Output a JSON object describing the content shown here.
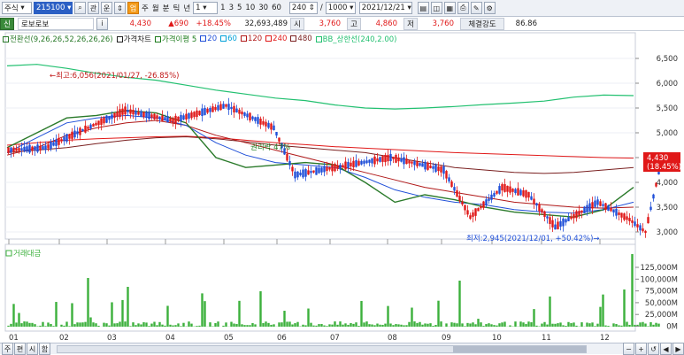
{
  "toolbar": {
    "market": "주식",
    "code": "215100",
    "search_icon": "search-icon",
    "btn_a": "관",
    "btn_b": "운",
    "btn_c": "주",
    "period_buttons": [
      "주",
      "월",
      "분",
      "틱",
      "년"
    ],
    "interval_select": "1",
    "interval_buttons": [
      "1",
      "3",
      "5",
      "10",
      "30",
      "60"
    ],
    "count_value": "240",
    "total_value": "1000",
    "date_value": "2021/12/21",
    "orange_label": "업"
  },
  "quote": {
    "market_badge": "신",
    "name": "로보로보",
    "price": "4,430",
    "change": "▲690",
    "change_pct": "+18.45%",
    "volume": "32,693,489",
    "open_label": "시",
    "open": "3,760",
    "high_label": "고",
    "high": "4,860",
    "low_label": "저",
    "low": "3,760",
    "strength_label": "체결강도",
    "strength": "86.86"
  },
  "legend": {
    "items": [
      "전환선(9,26,26,52,26,26,26)",
      "가격차트",
      "가격이평 5",
      "20",
      "60",
      "120",
      "240",
      "480",
      "BB_상한선(240,2.00)"
    ],
    "colors": [
      "#2a7a2a",
      "#222222",
      "#1a7a1a",
      "#1f4fd8",
      "#00a0d8",
      "#b01818",
      "#e01818",
      "#7a2020",
      "#22c070"
    ]
  },
  "price_chart": {
    "yticks": [
      "6,500",
      "6,000",
      "5,500",
      "5,000",
      "4,500",
      "4,000",
      "3,500",
      "3,000"
    ],
    "current_price_label": "4,430",
    "current_pct_label": "(18.45%)",
    "high_annotation": "←최고:6,056(2021/01/27, -26.85%)",
    "low_annotation": "최저:2,945(2021/12/01, +50.42%)→",
    "event_annotation": "권리락 47%"
  },
  "volume_chart": {
    "legend": "거래대금",
    "yticks": [
      "125,000M",
      "100,000M",
      "75,000M",
      "50,000M",
      "25,000M",
      "0M"
    ]
  },
  "xaxis": {
    "months": [
      "01",
      "02",
      "03",
      "04",
      "05",
      "06",
      "07",
      "08",
      "09",
      "10",
      "11",
      "12"
    ]
  },
  "bottom": {
    "tabs": [
      "주",
      "편",
      "시",
      "함"
    ]
  },
  "colors": {
    "up": "#e01818",
    "down": "#1f4fd8",
    "bb_upper": "#22c070",
    "volume": "#3cb03c"
  }
}
